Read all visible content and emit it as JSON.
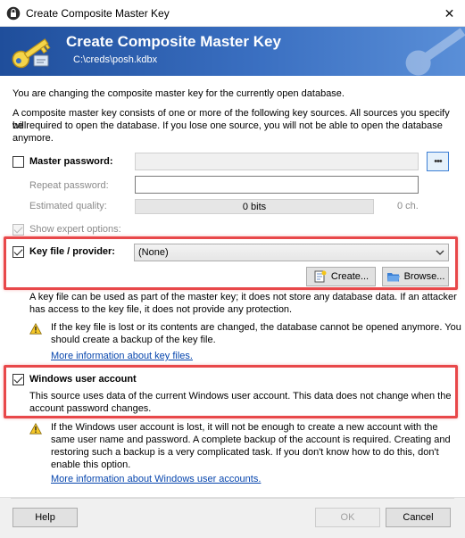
{
  "window": {
    "title": "Create Composite Master Key",
    "close_glyph": "✕"
  },
  "banner": {
    "title": "Create Composite Master Key",
    "path": "C:\\creds\\posh.kdbx"
  },
  "intro": {
    "line1": "You are changing the composite master key for the currently open database.",
    "para_l1": "A composite master key consists of one or more of the following key sources. All sources you specify will",
    "para_l2": "be required to open the database. If you lose one source, you will not be able to open the database",
    "para_l3": "anymore."
  },
  "master_password": {
    "label": "Master password:",
    "checked": false,
    "repeat_label": "Repeat password:",
    "quality_label": "Estimated quality:",
    "quality_value": "0 bits",
    "char_count": "0 ch.",
    "reveal_glyph": "•••",
    "show_expert": "Show expert options:"
  },
  "key_file": {
    "label": "Key file / provider:",
    "checked": true,
    "selected": "(None)",
    "create_label": "Create...",
    "browse_label": "Browse...",
    "desc_l1": "A key file can be used as part of the master key; it does not store any database data. If an attacker",
    "desc_l2": "has access to the key file, it does not provide any protection.",
    "warn_l1": "If the key file is lost or its contents are changed, the database cannot be opened anymore. You",
    "warn_l2": "should create a backup of the key file.",
    "more_info": "More information about key files."
  },
  "windows_account": {
    "label": "Windows user account",
    "checked": true,
    "desc_l1": "This source uses data of the current Windows user account. This data does not change when the",
    "desc_l2": "account password changes.",
    "warn_l1": "If the Windows user account is lost, it will not be enough to create a new account with the",
    "warn_l2": "same user name and password. A complete backup of the account is required. Creating and",
    "warn_l3": "restoring such a backup is a very complicated task. If you don't know how to do this, don't",
    "warn_l4": "enable this option.",
    "more_info": "More information about Windows user accounts."
  },
  "footer": {
    "help": "Help",
    "ok": "OK",
    "cancel": "Cancel"
  },
  "colors": {
    "accent": "#1f4e9b",
    "highlight": "#e8484a",
    "link": "#0645ad"
  }
}
